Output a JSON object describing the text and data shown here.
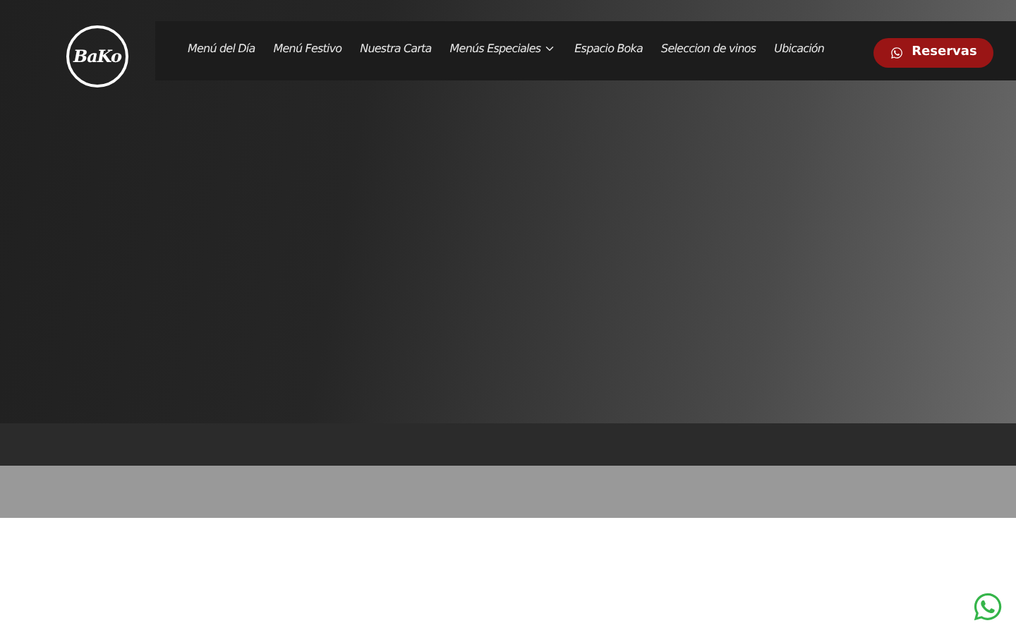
{
  "logo": {
    "text": "BaKo"
  },
  "nav": [
    {
      "label": "Menú del Día",
      "kind": "link"
    },
    {
      "label": "Menú Festivo",
      "kind": "link"
    },
    {
      "label": "Nuestra Carta",
      "kind": "link"
    },
    {
      "label": "Menús Especiales",
      "kind": "dropdown"
    },
    {
      "label": "Espacio Boka",
      "kind": "link"
    },
    {
      "label": "Seleccion de vinos",
      "kind": "link"
    },
    {
      "label": "Ubicación",
      "kind": "link"
    }
  ],
  "cta": {
    "label": "Reservas"
  }
}
